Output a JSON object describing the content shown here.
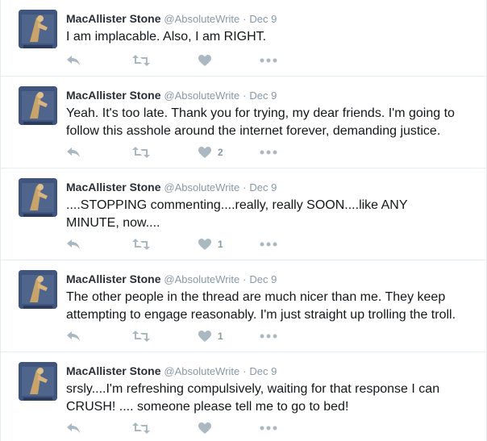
{
  "colors": {
    "icon": "#aab8c2",
    "meta": "#8899a6",
    "name": "#292f33",
    "border": "#e6ecf0"
  },
  "tweets": [
    {
      "name": "MacAllister Stone",
      "handle": "@AbsoluteWrite",
      "dot": "·",
      "time": "Dec 9",
      "text": "I am implacable. Also, I am RIGHT.",
      "likes": ""
    },
    {
      "name": "MacAllister Stone",
      "handle": "@AbsoluteWrite",
      "dot": "·",
      "time": "Dec 9",
      "text": "Yeah. It's too late. Thank you for trying, my dear friends. I'm going to follow this asshole around the internet forever, demanding justice.",
      "likes": "2"
    },
    {
      "name": "MacAllister Stone",
      "handle": "@AbsoluteWrite",
      "dot": "·",
      "time": "Dec 9",
      "text": "....STOPPING commenting....really, really SOON....like ANY MINUTE, now....",
      "likes": "1"
    },
    {
      "name": "MacAllister Stone",
      "handle": "@AbsoluteWrite",
      "dot": "·",
      "time": "Dec 9",
      "text": "The other people in the thread are much nicer than me. They keep attempting to engage reasonably. I'm just straight up trolling the troll.",
      "likes": "1"
    },
    {
      "name": "MacAllister Stone",
      "handle": "@AbsoluteWrite",
      "dot": "·",
      "time": "Dec 9",
      "text": "srsly....I'm refreshing compulsively, waiting for that response I can CRUSH! .... someone please tell me to go to bed!",
      "likes": ""
    }
  ],
  "icons": {
    "reply": "reply-icon",
    "retweet": "retweet-icon",
    "like": "heart-icon",
    "more": "more-icon"
  }
}
